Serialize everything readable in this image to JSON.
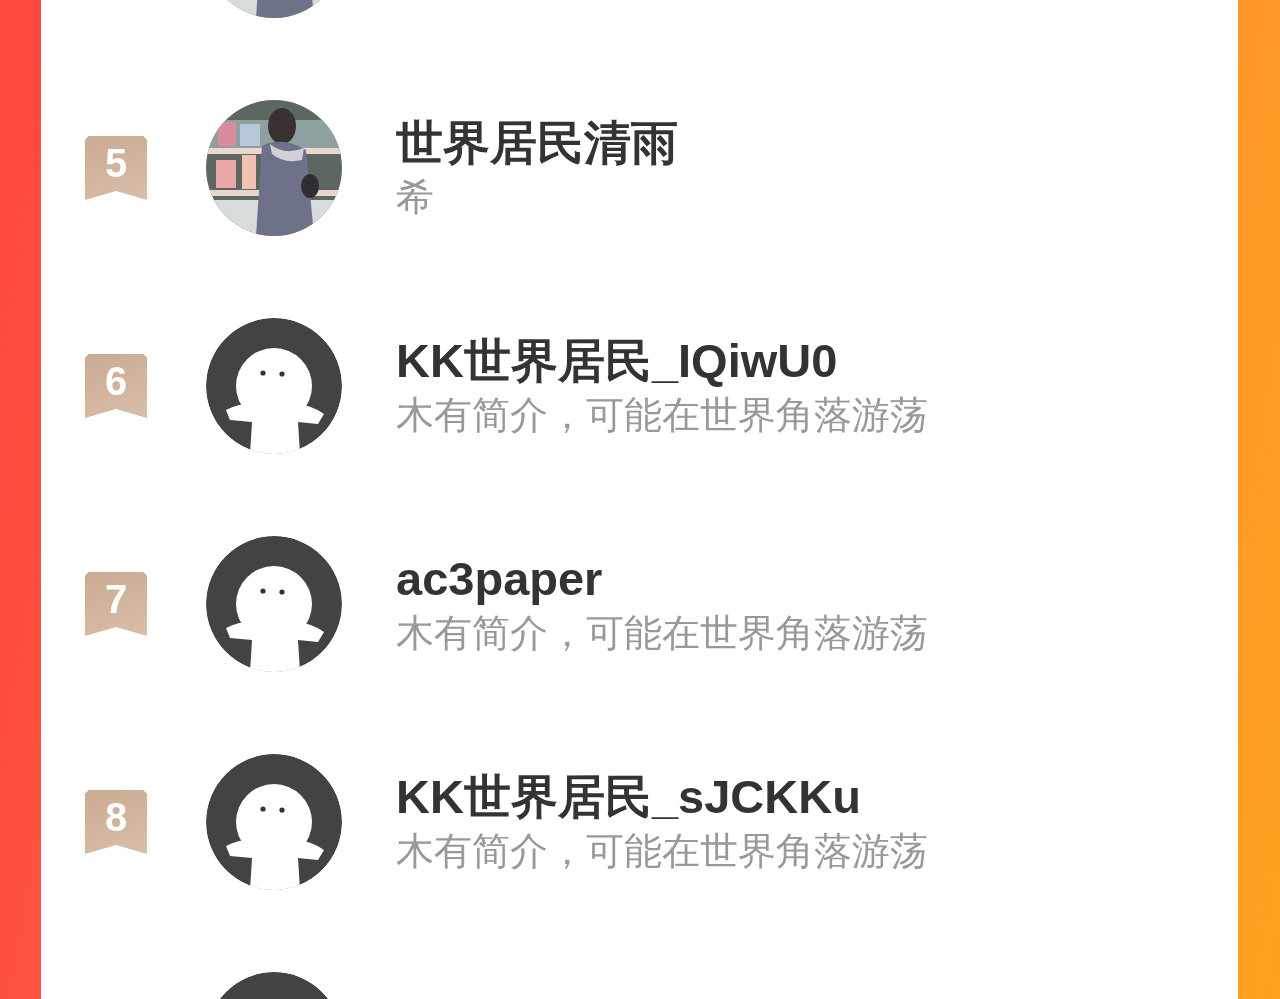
{
  "rows": [
    {
      "kind": "picture"
    },
    {
      "rank": "5",
      "name": "世界居民清雨",
      "bio": "希",
      "kind": "picture"
    },
    {
      "rank": "6",
      "name": "KK世界居民_IQiwU0",
      "bio": "木有简介，可能在世界角落游荡",
      "kind": "default"
    },
    {
      "rank": "7",
      "name": "ac3paper",
      "bio": "木有简介，可能在世界角落游荡",
      "kind": "default"
    },
    {
      "rank": "8",
      "name": "KK世界居民_sJCKKu",
      "bio": "木有简介，可能在世界角落游荡",
      "kind": "default"
    },
    {
      "kind": "default"
    }
  ]
}
